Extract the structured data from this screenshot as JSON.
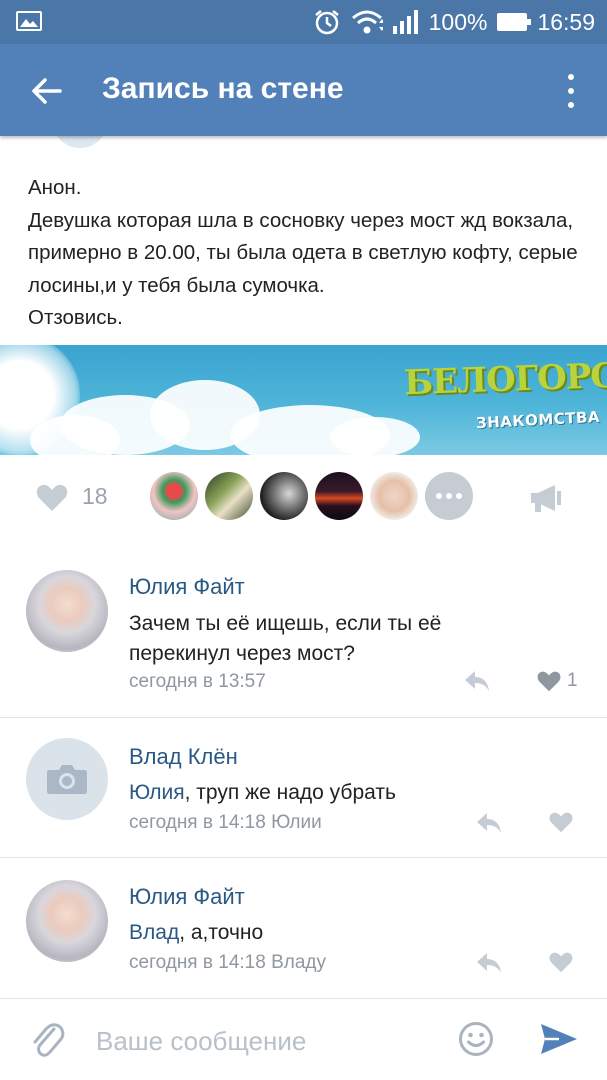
{
  "status_bar": {
    "battery": "100%",
    "time": "16:59"
  },
  "app_bar": {
    "title": "Запись на стене"
  },
  "post": {
    "text_lines": [
      "Анон.",
      "Девушка которая шла в сосновку через мост жд вокзала, примерно в 20.00, ты была одета в светлую кофту, серые лосины,и у тебя была сумочка.",
      "Отзовись."
    ],
    "banner": {
      "logo": "БЕЛОГОРСК",
      "subtitle": "ЗНАКОМСТВА"
    },
    "likes_count": "18"
  },
  "comments": [
    {
      "author": "Юлия Файт",
      "mention": "",
      "text": "Зачем ты её ищешь, если ты её перекинул через мост?",
      "meta": "сегодня в 13:57",
      "likes": "1"
    },
    {
      "author": "Влад Клён",
      "mention": "Юлия",
      "text": ", труп же надо убрать",
      "meta": "сегодня в 14:18 Юлии",
      "likes": ""
    },
    {
      "author": "Юлия Файт",
      "mention": "Влад",
      "text": ", а,точно",
      "meta": "сегодня в 14:18 Владу",
      "likes": ""
    }
  ],
  "input": {
    "placeholder": "Ваше сообщение"
  },
  "colors": {
    "header": "#5181b8",
    "status_bar": "#4a76a8",
    "link": "#2a5885",
    "send": "#5181b8"
  },
  "icons": [
    "gallery-icon",
    "alarm-icon",
    "wifi-icon",
    "signal-icon",
    "battery-icon",
    "back-arrow-icon",
    "more-vert-icon",
    "heart-icon",
    "share-megaphone-icon",
    "reply-icon",
    "camera-icon",
    "paperclip-icon",
    "smile-icon",
    "send-icon"
  ]
}
